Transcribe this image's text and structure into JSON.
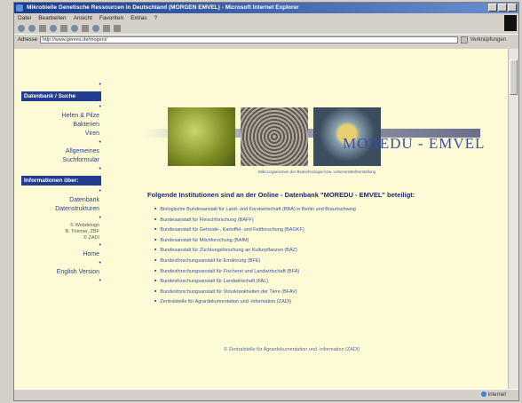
{
  "window": {
    "title": "Mikrobielle Genetische Ressourcen in Deutschland (MORGEN EMVEL) - Microsoft Internet Explorer"
  },
  "menu": [
    "Datei",
    "Bearbeiten",
    "Ansicht",
    "Favoriten",
    "Extras",
    "?"
  ],
  "address": {
    "label": "Adresse",
    "value": "http://www.genres.de/mogeni/",
    "links_label": "Verknüpfungen"
  },
  "status": {
    "zone": "Internet"
  },
  "nav": {
    "section1": "Datenbank / Suche",
    "links1": [
      "Hefen & Pilze",
      "Bakterien",
      "Viren"
    ],
    "general_search": [
      "Allgemeines",
      "Suchformular"
    ],
    "section2": "Informationen über:",
    "links2": [
      "Datenbank",
      "Datenstrukturen"
    ],
    "small": [
      "© Webdesign",
      "B. Triemer, ZBF",
      "© ZADI"
    ],
    "home": "Home",
    "english": "English Version"
  },
  "banner": {
    "logo": "MOREDU - EMVEL",
    "subtitle": "Mikroorganismen der Biotechnologie bzw. Lebensmittelherstellung"
  },
  "heading": "Folgende Institutionen sind an der Online - Datenbank \"MOREDU - EMVEL\" beteiligt:",
  "institutions": [
    "Biologische Bundesanstalt für Land- und Forstwirtschaft (BBA) in Berlin und Braunschweig",
    "Bundesanstalt für Fleischforschung (BAFF)",
    "Bundesanstalt für Getreide-, Kartoffel- und Fettforschung (BAGKF)",
    "Bundesanstalt für Milchforschung (BAfM)",
    "Bundesanstalt für Züchtungsforschung an Kulturpflanzen (BAZ)",
    "Bundesforschungsanstalt für Ernährung (BFE)",
    "Bundesforschungsanstalt für Fischerei und Landwirtschaft (BFA)",
    "Bundesforschungsanstalt für Landwirtschaft (FAL)",
    "Bundesforschungsanstalt für Viruskrankheiten der Tiere (BFAV)",
    "Zentralstelle für Agrardokumentation und -information (ZADI)"
  ],
  "footer_note": "© Zentralstelle für Agrardokumentation und -information (ZADI)"
}
